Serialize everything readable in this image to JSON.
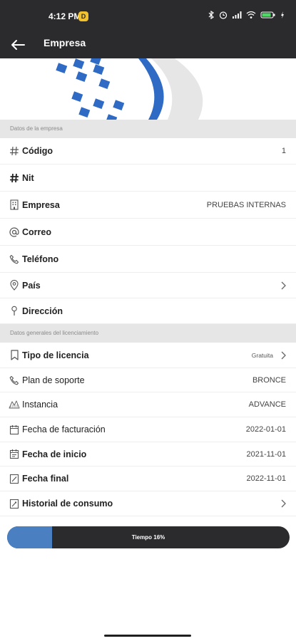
{
  "status_bar": {
    "time": "4:12 PM",
    "badge": "D"
  },
  "app_bar": {
    "title": "Empresa",
    "back_icon": "arrow-left-icon"
  },
  "company_section": {
    "header": "Datos de la empresa",
    "rows": [
      {
        "label": "Código",
        "value": "1",
        "icon": "hash-icon",
        "chevron": false
      },
      {
        "label": "Nit",
        "value": "",
        "icon": "hash-icon",
        "chevron": false
      },
      {
        "label": "Empresa",
        "value": "PRUEBAS INTERNAS",
        "icon": "building-icon",
        "chevron": false
      },
      {
        "label": "Correo",
        "value": "",
        "icon": "at-icon",
        "chevron": false
      },
      {
        "label": "Teléfono",
        "value": "",
        "icon": "phone-icon",
        "chevron": false
      },
      {
        "label": "País",
        "value": "",
        "icon": "location-pin-icon",
        "chevron": true
      },
      {
        "label": "Dirección",
        "value": "",
        "icon": "map-pin-icon",
        "chevron": false
      }
    ]
  },
  "license_section": {
    "header": "Datos generales del licenciamiento",
    "rows": [
      {
        "label": "Tipo de licencia",
        "value": "Gratuita",
        "icon": "bookmark-icon",
        "chevron": true
      },
      {
        "label": "Plan de soporte",
        "value": "BRONCE",
        "icon": "phone-icon",
        "chevron": false
      },
      {
        "label": "Instancia",
        "value": "ADVANCE",
        "icon": "instance-icon",
        "chevron": false
      },
      {
        "label": "Fecha de facturación",
        "value": "2022-01-01",
        "icon": "calendar-icon",
        "chevron": false
      },
      {
        "label": "Fecha de inicio",
        "value": "2021-11-01",
        "icon": "calendar-start-icon",
        "chevron": false
      },
      {
        "label": "Fecha final",
        "value": "2022-11-01",
        "icon": "calendar-end-icon",
        "chevron": false
      },
      {
        "label": "Historial de consumo",
        "value": "",
        "icon": "history-icon",
        "chevron": true
      }
    ]
  },
  "progress": {
    "label": "Tiempo 16%",
    "fraction": 0.16
  },
  "colors": {
    "bar_bg": "#2b2b2e",
    "accent": "#4a7fc1",
    "section_bg": "#e6e6e6"
  }
}
